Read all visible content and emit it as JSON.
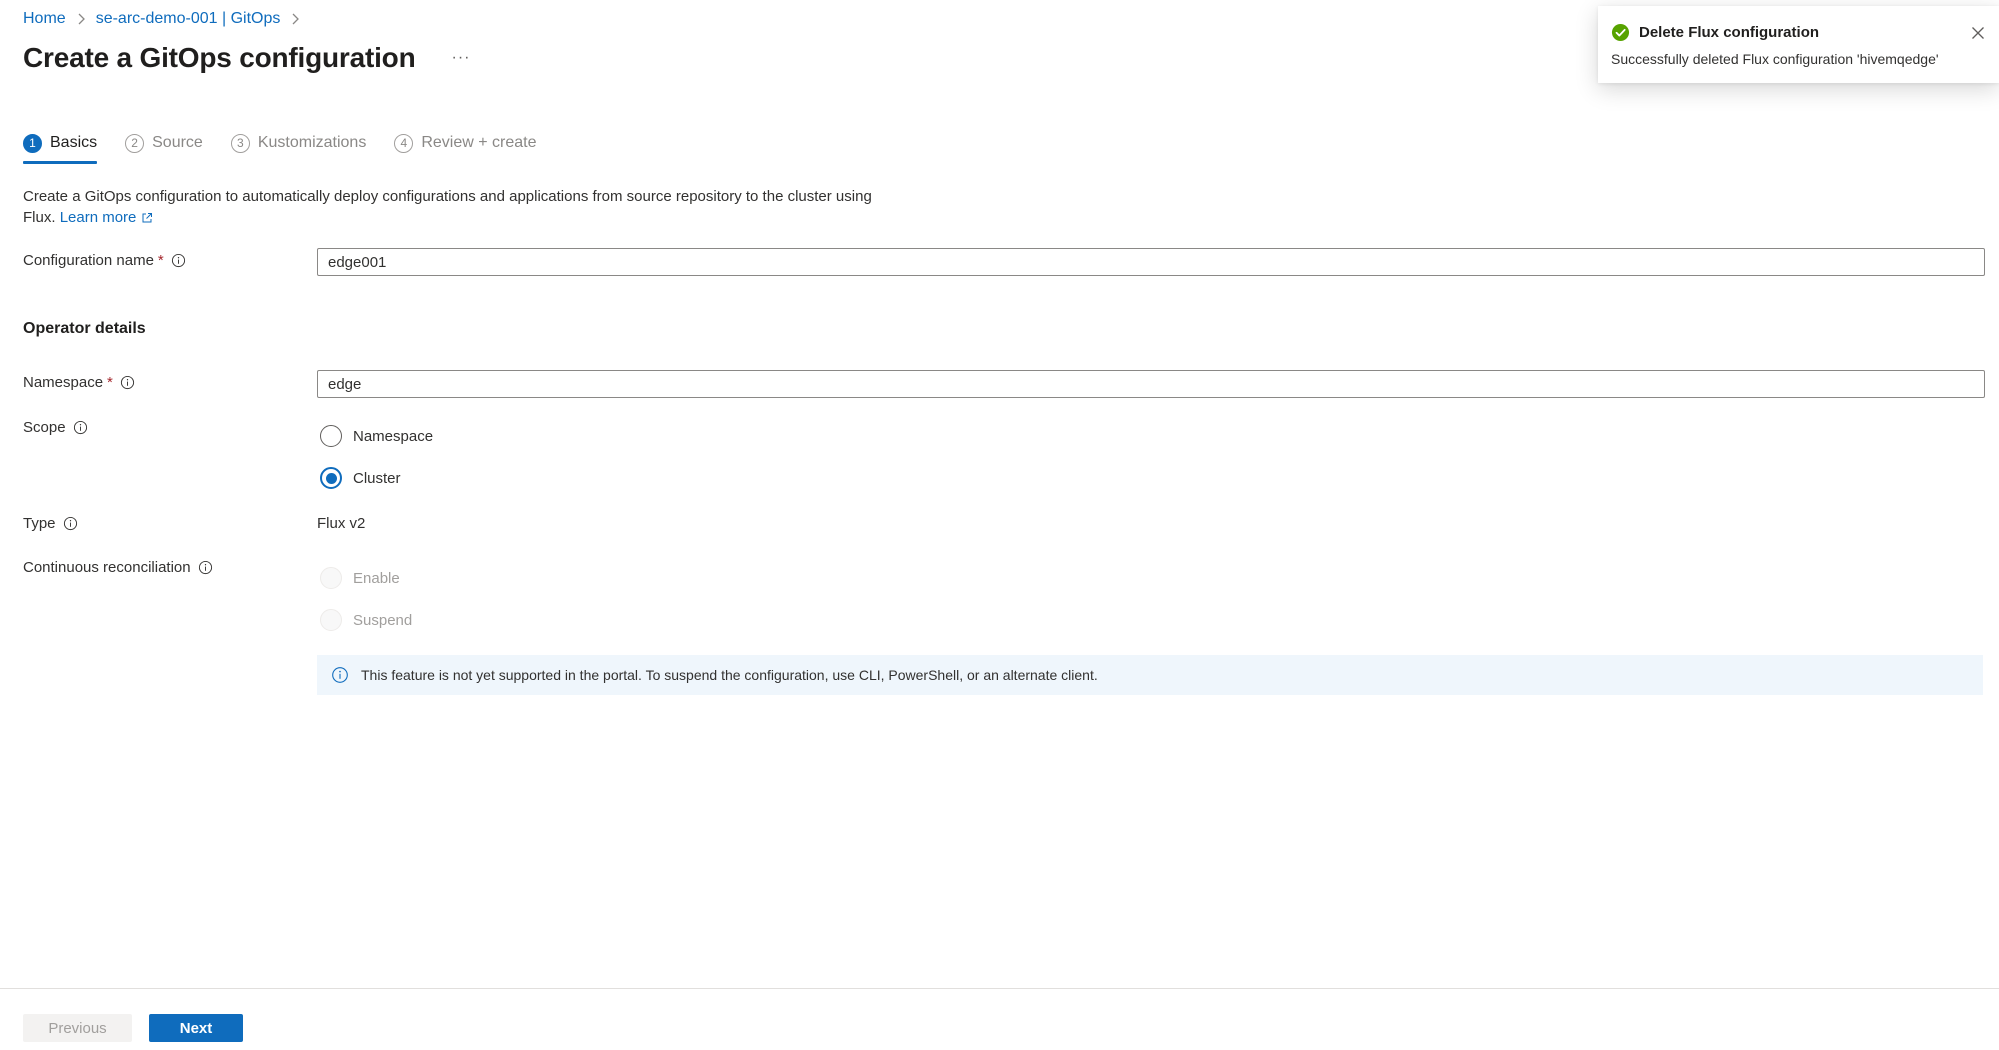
{
  "breadcrumb": {
    "items": [
      "Home",
      "se-arc-demo-001 | GitOps"
    ]
  },
  "page": {
    "title": "Create a GitOps configuration",
    "more": "···"
  },
  "tabs": [
    {
      "step": "1",
      "label": "Basics",
      "active": true
    },
    {
      "step": "2",
      "label": "Source",
      "active": false
    },
    {
      "step": "3",
      "label": "Kustomizations",
      "active": false
    },
    {
      "step": "4",
      "label": "Review + create",
      "active": false
    }
  ],
  "description": {
    "text": "Create a GitOps configuration to automatically deploy configurations and applications from source repository to the cluster using Flux.",
    "learn_more": "Learn more"
  },
  "form": {
    "configuration_name": {
      "label": "Configuration name",
      "required_mark": "*",
      "value": "edge001"
    },
    "operator_heading": "Operator details",
    "namespace": {
      "label": "Namespace",
      "required_mark": "*",
      "value": "edge"
    },
    "scope": {
      "label": "Scope",
      "options": [
        "Namespace",
        "Cluster"
      ],
      "selected": "Cluster"
    },
    "type": {
      "label": "Type",
      "value": "Flux v2"
    },
    "continuous_reconciliation": {
      "label": "Continuous reconciliation",
      "options": [
        "Enable",
        "Suspend"
      ],
      "disabled": true
    },
    "info_message": "This feature is not yet supported in the portal. To suspend the configuration, use CLI, PowerShell, or an alternate client."
  },
  "footer": {
    "previous_label": "Previous",
    "next_label": "Next"
  },
  "toast": {
    "title": "Delete Flux configuration",
    "message": "Successfully deleted Flux configuration 'hivemqedge'",
    "status_color": "#57a300"
  },
  "colors": {
    "accent": "#0f6cbd",
    "required": "#a4262c",
    "info_bg": "#eff6fc"
  }
}
